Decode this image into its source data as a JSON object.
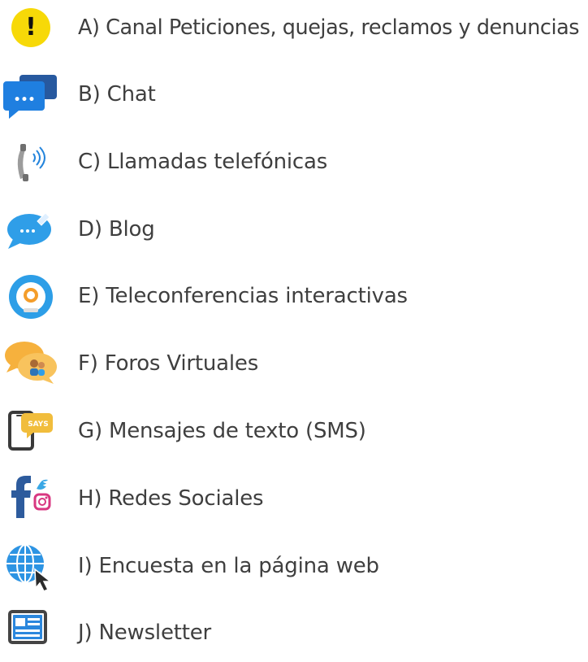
{
  "channels": [
    {
      "label": "A) Canal Peticiones, quejas, reclamos y denuncias",
      "icon": "alert-circle-icon"
    },
    {
      "label": "B) Chat",
      "icon": "chat-bubbles-icon"
    },
    {
      "label": "C) Llamadas telefónicas",
      "icon": "phone-call-icon"
    },
    {
      "label": "D) Blog",
      "icon": "blog-bubble-icon"
    },
    {
      "label": "E) Teleconferencias interactivas",
      "icon": "webcam-icon"
    },
    {
      "label": "F) Foros Virtuales",
      "icon": "forum-bubbles-icon"
    },
    {
      "label": "G) Mensajes de texto (SMS)",
      "icon": "mobile-sms-icon"
    },
    {
      "label": "H) Redes Sociales",
      "icon": "social-networks-icon"
    },
    {
      "label": "I) Encuesta en la página web",
      "icon": "web-globe-cursor-icon"
    },
    {
      "label": "J) Newsletter",
      "icon": "newsletter-icon"
    }
  ],
  "icon_text": {
    "alert": "!",
    "chat_dots": "•••",
    "sms": "SAYS"
  },
  "colors": {
    "text": "#3f3f3f",
    "alert_yellow": "#f7d908",
    "chat_blue": "#1f7fe0",
    "chat_dark_blue": "#27599f",
    "phone_gray": "#9c9c9c",
    "phone_wave_blue": "#2384dc",
    "blog_blue": "#2f9ee8",
    "webcam_blue": "#2d9ee7",
    "webcam_orange": "#f49d2a",
    "forum_orange": "#f6b13d",
    "sms_yellow": "#f1bd3c",
    "facebook_blue": "#2d5b9d",
    "twitter_blue": "#39a7e5",
    "instagram_pink": "#d83780",
    "globe_blue": "#2d94e3",
    "newsletter_blue": "#2b87dd"
  }
}
